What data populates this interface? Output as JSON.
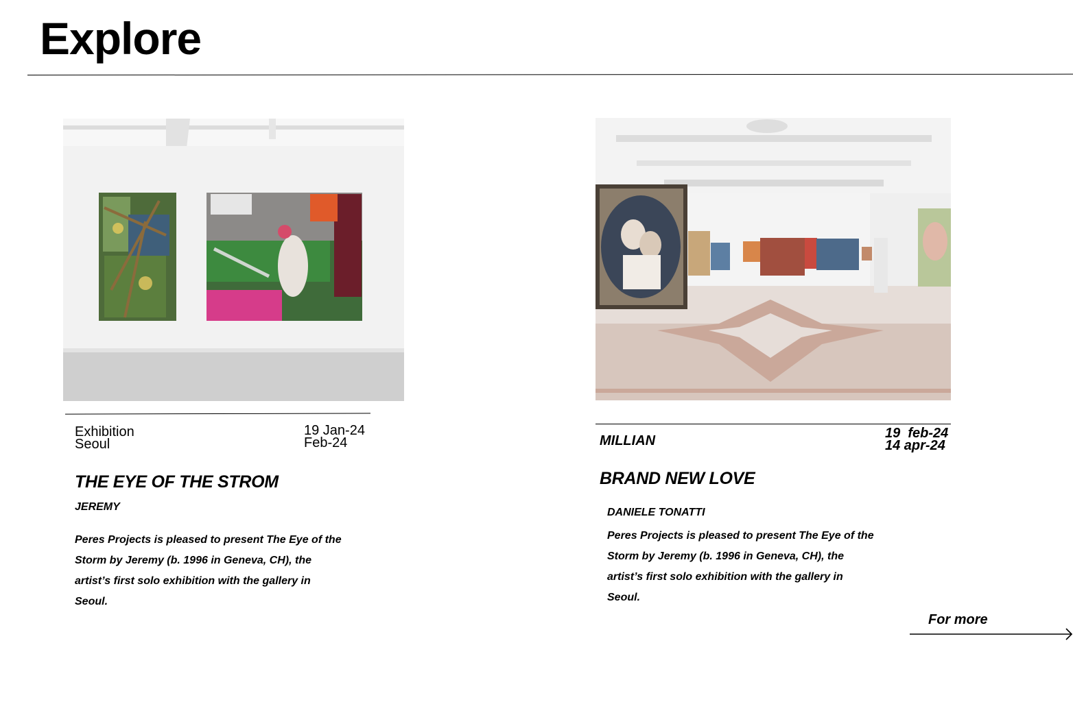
{
  "page": {
    "title": "Explore"
  },
  "cards": [
    {
      "category": "Exhibition",
      "city": "Seoul",
      "date_start": "19 Jan-24",
      "date_end": "Feb-24",
      "title": "THE EYE OF THE STROM",
      "artist": "JEREMY",
      "description": "Peres Projects is pleased to present The Eye of the Storm by Jeremy (b. 1996 in Geneva, CH), the artist’s first solo exhibition with the gallery in Seoul.",
      "image_icon": "gallery-photo-white-room"
    },
    {
      "category": "MILLIAN",
      "date_start": "19  feb-24",
      "date_end": "14 apr-24",
      "title": "BRAND NEW LOVE",
      "artist": "DANIELE TONATTI",
      "description": "Peres Projects is pleased to present The Eye of the Storm by Jeremy (b. 1996 in Geneva, CH), the artist’s first solo exhibition with the gallery in Seoul.",
      "image_icon": "gallery-photo-ornate-room"
    }
  ],
  "footer": {
    "for_more_label": "For more",
    "arrow_icon": "arrow-right-icon"
  }
}
